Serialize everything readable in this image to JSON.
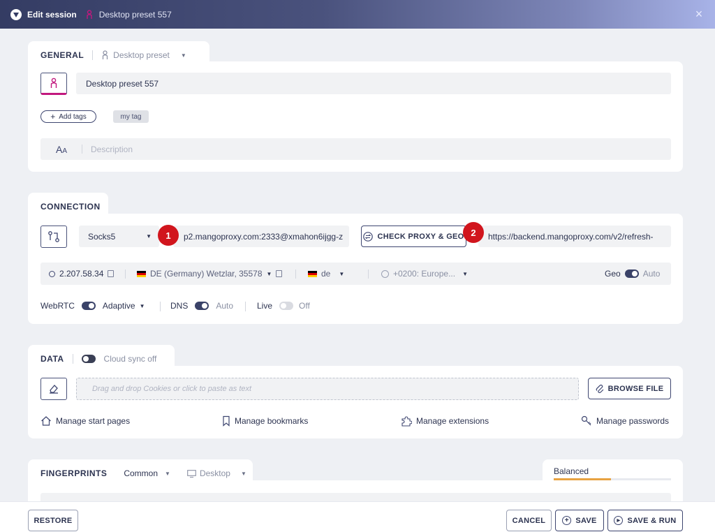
{
  "titlebar": {
    "title": "Edit session",
    "session_name": "Desktop preset 557"
  },
  "general": {
    "tab_label": "GENERAL",
    "preset_label": "Desktop preset",
    "name_value": "Desktop preset 557",
    "add_tags_label": "Add tags",
    "tags": [
      "my tag"
    ],
    "description_placeholder": "Description",
    "accent": "#c2187e"
  },
  "connection": {
    "tab_label": "CONNECTION",
    "proxy_type": "Socks5",
    "proxy_string": "p2.mangoproxy.com:2333@xmahon6ijgg-z",
    "check_button": "CHECK PROXY & GEO",
    "refresh_url": "https://backend.mangoproxy.com/v2/refresh-",
    "badge_1": "1",
    "badge_2": "2",
    "ip": "2.207.58.34",
    "geo_location": "DE (Germany) Wetzlar, 35578",
    "language": "de",
    "timezone": "+0200: Europe...",
    "geo_label": "Geo",
    "geo_auto": "Auto",
    "webrtc_label": "WebRTC",
    "webrtc_mode": "Adaptive",
    "dns_label": "DNS",
    "dns_auto": "Auto",
    "live_label": "Live",
    "live_state": "Off"
  },
  "data": {
    "tab_label": "DATA",
    "cloud_sync": "Cloud sync off",
    "drop_placeholder": "Drag and drop Cookies or click to paste as text",
    "browse_button": "BROWSE FILE",
    "links": [
      "Manage start pages",
      "Manage bookmarks",
      "Manage extensions",
      "Manage passwords"
    ]
  },
  "fingerprints": {
    "tab_label": "FINGERPRINTS",
    "mode": "Common",
    "platform": "Desktop",
    "balance_label": "Balanced",
    "balance_level": 0.49
  },
  "footer": {
    "restore": "RESTORE",
    "cancel": "CANCEL",
    "save": "SAVE",
    "save_run": "SAVE & RUN"
  }
}
